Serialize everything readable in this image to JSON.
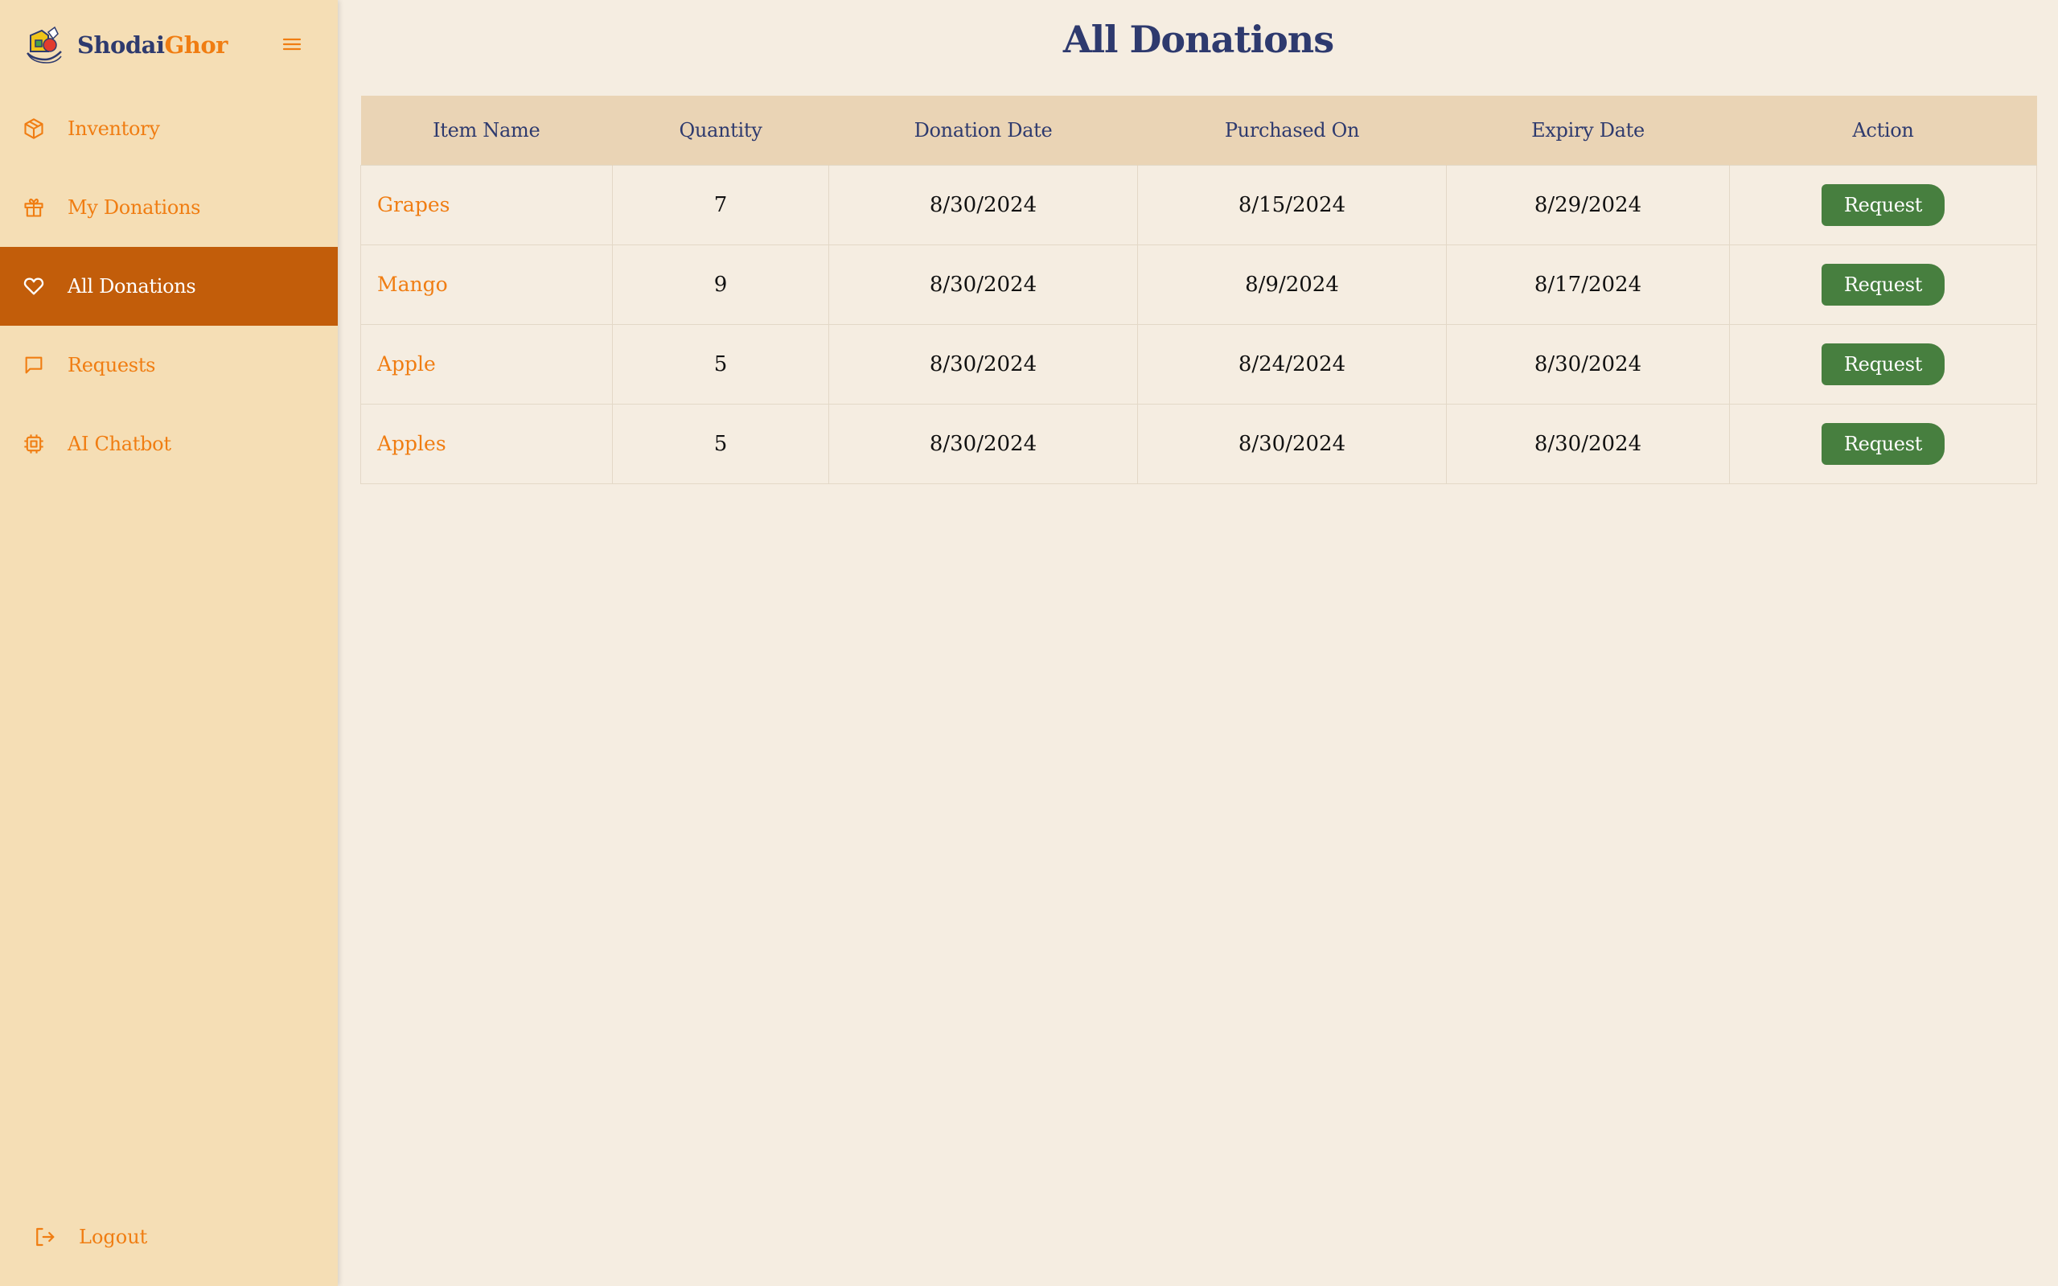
{
  "brand": {
    "part1": "Shodai",
    "part2": "Ghor"
  },
  "colors": {
    "sidebar_bg": "#f5deb5",
    "accent": "#f07d12",
    "active_bg": "#c25d0a",
    "navy": "#2e3a6e",
    "button_green": "#477f3f"
  },
  "sidebar": {
    "items": [
      {
        "label": "Inventory",
        "icon": "box-icon"
      },
      {
        "label": "My Donations",
        "icon": "gift-icon"
      },
      {
        "label": "All Donations",
        "icon": "heart-icon",
        "active": true
      },
      {
        "label": "Requests",
        "icon": "message-icon"
      },
      {
        "label": "AI Chatbot",
        "icon": "chip-icon"
      }
    ],
    "logout": "Logout"
  },
  "page": {
    "title": "All Donations"
  },
  "table": {
    "headers": [
      "Item Name",
      "Quantity",
      "Donation Date",
      "Purchased On",
      "Expiry Date",
      "Action"
    ],
    "rows": [
      {
        "item": "Grapes",
        "quantity": "7",
        "donation_date": "8/30/2024",
        "purchased_on": "8/15/2024",
        "expiry_date": "8/29/2024",
        "action": "Request"
      },
      {
        "item": "Mango",
        "quantity": "9",
        "donation_date": "8/30/2024",
        "purchased_on": "8/9/2024",
        "expiry_date": "8/17/2024",
        "action": "Request"
      },
      {
        "item": "Apple",
        "quantity": "5",
        "donation_date": "8/30/2024",
        "purchased_on": "8/24/2024",
        "expiry_date": "8/30/2024",
        "action": "Request"
      },
      {
        "item": "Apples",
        "quantity": "5",
        "donation_date": "8/30/2024",
        "purchased_on": "8/30/2024",
        "expiry_date": "8/30/2024",
        "action": "Request"
      }
    ]
  }
}
